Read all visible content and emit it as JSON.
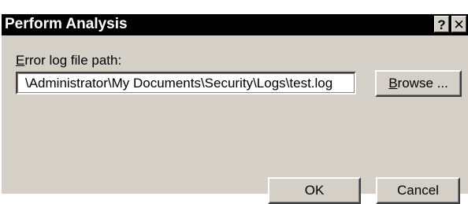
{
  "window": {
    "title": "Perform Analysis",
    "help_glyph": "?",
    "close_glyph": "✕"
  },
  "form": {
    "path_label_prefix": "E",
    "path_label_rest": "rror log file path:",
    "path_value": "\\Administrator\\My Documents\\Security\\Logs\\test.log",
    "browse_prefix": "B",
    "browse_rest": "rowse ..."
  },
  "buttons": {
    "ok": "OK",
    "cancel": "Cancel"
  },
  "colors": {
    "titlebar": "#000000",
    "title_text": "#ffffff",
    "dialog_face": "#d4d0c8",
    "field_bg": "#ffffff"
  }
}
